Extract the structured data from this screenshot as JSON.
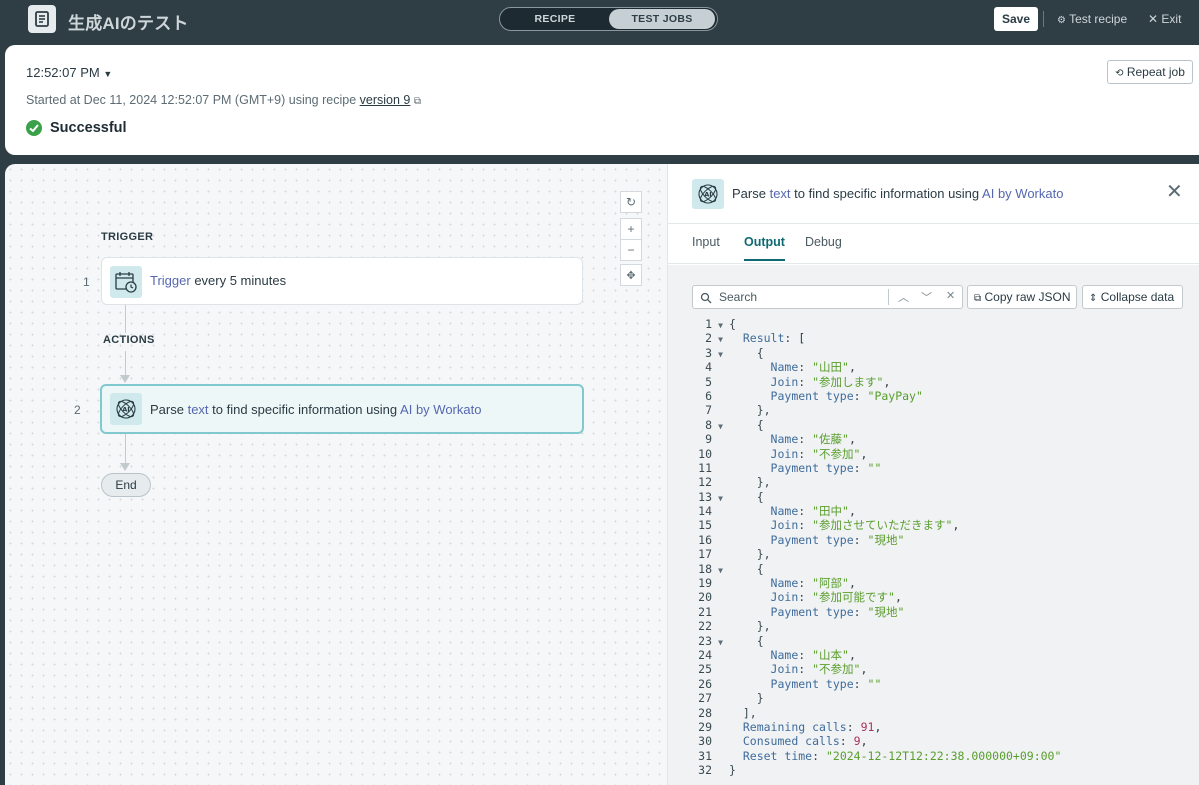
{
  "topbar": {
    "app_title": "生成AIのテスト",
    "mode_recipe": "RECIPE",
    "mode_test_jobs": "TEST JOBS",
    "save_label": "Save",
    "test_recipe_label": "Test recipe",
    "exit_label": "Exit"
  },
  "job": {
    "time": "12:52:07 PM",
    "started_prefix": "Started at Dec 11, 2024 12:52:07 PM (GMT+9) using recipe",
    "version_link": "version 9",
    "status": "Successful",
    "repeat_label": "Repeat job"
  },
  "canvas": {
    "trigger_section": "TRIGGER",
    "actions_section": "ACTIONS",
    "step1": {
      "number": "1",
      "keyword": "Trigger",
      "rest": " every 5 minutes"
    },
    "step2": {
      "number": "2",
      "prefix": "Parse ",
      "pill": "text",
      "middle": " to find specific information using ",
      "app": "AI by Workato"
    },
    "end_label": "End"
  },
  "panel": {
    "title_prefix": "Parse ",
    "title_pill": "text",
    "title_middle": " to find specific information using ",
    "title_app": "AI by Workato",
    "tabs": [
      "Input",
      "Output",
      "Debug"
    ],
    "active_tab": "Output",
    "search_placeholder": "Search",
    "copy_raw_json": "Copy raw JSON",
    "collapse_data": "Collapse data"
  },
  "output_lines": [
    "{",
    "  Result: [",
    "    {",
    "      Name: \"山田\",",
    "      Join: \"参加します\",",
    "      Payment type: \"PayPay\"",
    "    },",
    "    {",
    "      Name: \"佐藤\",",
    "      Join: \"不参加\",",
    "      Payment type: \"\"",
    "    },",
    "    {",
    "      Name: \"田中\",",
    "      Join: \"参加させていただきます\",",
    "      Payment type: \"現地\"",
    "    },",
    "    {",
    "      Name: \"阿部\",",
    "      Join: \"参加可能です\",",
    "      Payment type: \"現地\"",
    "    },",
    "    {",
    "      Name: \"山本\",",
    "      Join: \"不参加\",",
    "      Payment type: \"\"",
    "    }",
    "  ],",
    "  Remaining calls: 91,",
    "  Consumed calls: 9,",
    "  Reset time: \"2024-12-12T12:22:38.000000+09:00\"",
    "}"
  ],
  "foldable_lines": [
    1,
    2,
    3,
    8,
    13,
    18,
    23
  ],
  "colors": {
    "topbar_bg": "#2f3d45",
    "success": "#3aa14a",
    "accent": "#0e6a72",
    "key": "#3f6c9b",
    "string": "#5a9e2d",
    "number": "#a8345b"
  }
}
